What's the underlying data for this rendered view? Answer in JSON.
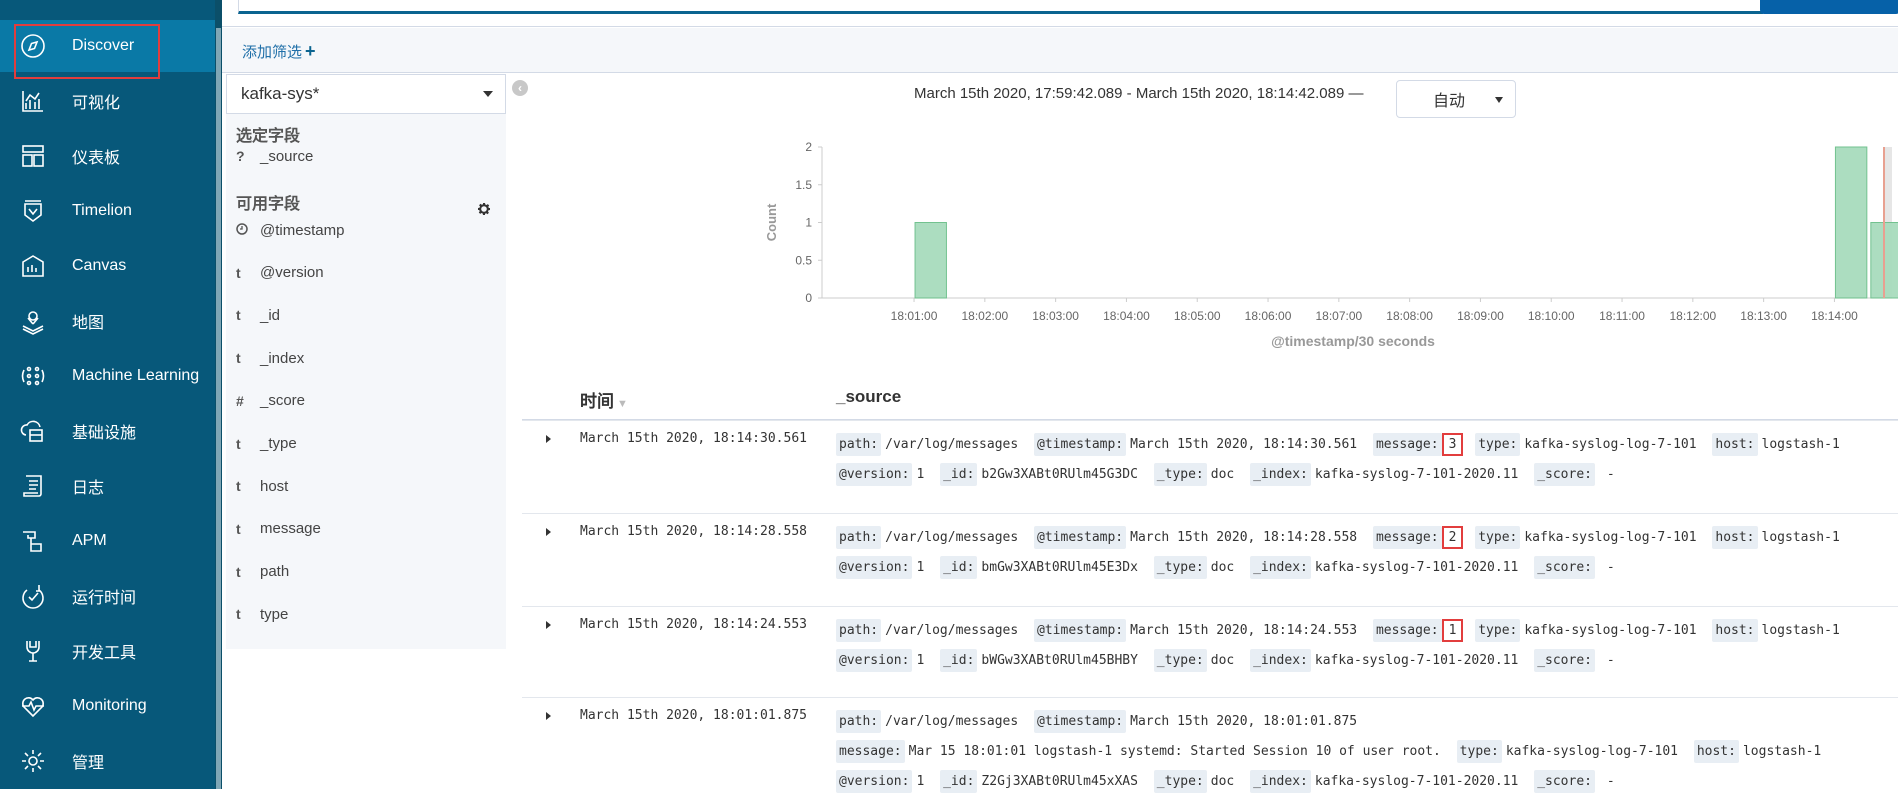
{
  "sidebar": {
    "items": [
      {
        "label": "Discover",
        "icon": "compass-icon",
        "active": true
      },
      {
        "label": "可视化",
        "icon": "visualize-icon"
      },
      {
        "label": "仪表板",
        "icon": "dashboard-icon"
      },
      {
        "label": "Timelion",
        "icon": "timelion-icon"
      },
      {
        "label": "Canvas",
        "icon": "canvas-icon"
      },
      {
        "label": "地图",
        "icon": "map-icon"
      },
      {
        "label": "Machine Learning",
        "icon": "machine-learning-icon"
      },
      {
        "label": "基础设施",
        "icon": "infrastructure-icon"
      },
      {
        "label": "日志",
        "icon": "logs-icon"
      },
      {
        "label": "APM",
        "icon": "apm-icon"
      },
      {
        "label": "运行时间",
        "icon": "uptime-icon"
      },
      {
        "label": "开发工具",
        "icon": "dev-tools-icon"
      },
      {
        "label": "Monitoring",
        "icon": "monitoring-icon"
      },
      {
        "label": "管理",
        "icon": "gear-icon"
      }
    ]
  },
  "filter_bar": {
    "add_filter_label": "添加筛选",
    "add_filter_icon": "+"
  },
  "field_panel": {
    "index_pattern": "kafka-sys*",
    "selected_fields_title": "选定字段",
    "selected_fields": [
      {
        "type": "?",
        "name": "_source"
      }
    ],
    "available_fields_title": "可用字段",
    "available_fields": [
      {
        "type": "clock",
        "name": "@timestamp"
      },
      {
        "type": "t",
        "name": "@version"
      },
      {
        "type": "t",
        "name": "_id"
      },
      {
        "type": "t",
        "name": "_index"
      },
      {
        "type": "#",
        "name": "_score"
      },
      {
        "type": "t",
        "name": "_type"
      },
      {
        "type": "t",
        "name": "host"
      },
      {
        "type": "t",
        "name": "message"
      },
      {
        "type": "t",
        "name": "path"
      },
      {
        "type": "t",
        "name": "type"
      }
    ]
  },
  "time_range": "March 15th 2020, 17:59:42.089 - March 15th 2020, 18:14:42.089 —",
  "interval": {
    "selected": "自动"
  },
  "chart_data": {
    "type": "bar",
    "title": "",
    "xlabel": "@timestamp/30 seconds",
    "ylabel": "Count",
    "ylim": [
      0,
      2
    ],
    "yticks": [
      "0",
      "0.5",
      "1",
      "1.5",
      "2"
    ],
    "xticks": [
      "18:01:00",
      "18:02:00",
      "18:03:00",
      "18:04:00",
      "18:05:00",
      "18:06:00",
      "18:07:00",
      "18:08:00",
      "18:09:00",
      "18:10:00",
      "18:11:00",
      "18:12:00",
      "18:13:00",
      "18:14:00"
    ],
    "x_start": "17:59:42",
    "x_end": "18:14:42",
    "bucket_seconds": 30,
    "bars": [
      {
        "x": "18:01:00",
        "value": 1
      },
      {
        "x": "18:14:00",
        "value": 2
      },
      {
        "x": "18:14:30",
        "value": 1
      }
    ],
    "now_marker": "18:14:42",
    "bar_color": "#a8dcbd",
    "bar_stroke": "#6bbf8a",
    "marker_color": "#e8a090"
  },
  "table": {
    "time_header": "时间",
    "source_header": "_source",
    "rows": [
      {
        "time": "March 15th 2020, 18:14:30.561",
        "fields": [
          {
            "k": "path:",
            "v": "/var/log/messages"
          },
          {
            "k": "@timestamp:",
            "v": "March 15th 2020, 18:14:30.561"
          },
          {
            "k": "message:",
            "v": "3",
            "highlight": true
          },
          {
            "k": "type:",
            "v": "kafka-syslog-log-7-101"
          },
          {
            "k": "host:",
            "v": "logstash-1"
          },
          {
            "k": "@version:",
            "v": "1"
          },
          {
            "k": "_id:",
            "v": "b2Gw3XABt0RUlm45G3DC"
          },
          {
            "k": "_type:",
            "v": "doc"
          },
          {
            "k": "_index:",
            "v": "kafka-syslog-7-101-2020.11"
          },
          {
            "k": "_score:",
            "v": " -"
          }
        ]
      },
      {
        "time": "March 15th 2020, 18:14:28.558",
        "fields": [
          {
            "k": "path:",
            "v": "/var/log/messages"
          },
          {
            "k": "@timestamp:",
            "v": "March 15th 2020, 18:14:28.558"
          },
          {
            "k": "message:",
            "v": "2",
            "highlight": true
          },
          {
            "k": "type:",
            "v": "kafka-syslog-log-7-101"
          },
          {
            "k": "host:",
            "v": "logstash-1"
          },
          {
            "k": "@version:",
            "v": "1"
          },
          {
            "k": "_id:",
            "v": "bmGw3XABt0RUlm45E3Dx"
          },
          {
            "k": "_type:",
            "v": "doc"
          },
          {
            "k": "_index:",
            "v": "kafka-syslog-7-101-2020.11"
          },
          {
            "k": "_score:",
            "v": " -"
          }
        ]
      },
      {
        "time": "March 15th 2020, 18:14:24.553",
        "fields": [
          {
            "k": "path:",
            "v": "/var/log/messages"
          },
          {
            "k": "@timestamp:",
            "v": "March 15th 2020, 18:14:24.553"
          },
          {
            "k": "message:",
            "v": "1",
            "highlight": true
          },
          {
            "k": "type:",
            "v": "kafka-syslog-log-7-101"
          },
          {
            "k": "host:",
            "v": "logstash-1"
          },
          {
            "k": "@version:",
            "v": "1"
          },
          {
            "k": "_id:",
            "v": "bWGw3XABt0RUlm45BHBY"
          },
          {
            "k": "_type:",
            "v": "doc"
          },
          {
            "k": "_index:",
            "v": "kafka-syslog-7-101-2020.11"
          },
          {
            "k": "_score:",
            "v": " -"
          }
        ]
      },
      {
        "time": "March 15th 2020, 18:01:01.875",
        "fields": [
          {
            "k": "path:",
            "v": "/var/log/messages"
          },
          {
            "k": "@timestamp:",
            "v": "March 15th 2020, 18:01:01.875"
          },
          {
            "k": "message:",
            "v": "Mar 15 18:01:01 logstash-1 systemd: Started Session 10 of user root."
          },
          {
            "k": "type:",
            "v": "kafka-syslog-log-7-101"
          },
          {
            "k": "host:",
            "v": "logstash-1"
          },
          {
            "k": "@version:",
            "v": "1"
          },
          {
            "k": "_id:",
            "v": "Z2Gj3XABt0RUlm45xXAS"
          },
          {
            "k": "_type:",
            "v": "doc"
          },
          {
            "k": "_index:",
            "v": "kafka-syslog-7-101-2020.11"
          },
          {
            "k": "_score:",
            "v": " -"
          }
        ]
      }
    ]
  }
}
